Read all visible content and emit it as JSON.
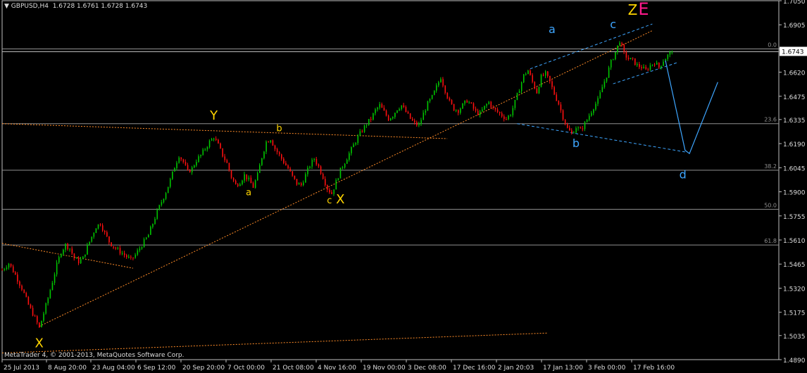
{
  "header": {
    "menu_glyph": "▼",
    "symbol": "GBPUSD,H4",
    "ohlc": "1.6728 1.6761 1.6728 1.6743"
  },
  "copyright": "MetaTrader 4, © 2001-2013, MetaQuotes Software Corp.",
  "colors": {
    "background": "#000000",
    "frame": "#c0c0c0",
    "grid": "#ffffff",
    "bull": "#00c800",
    "bear": "#ff1010",
    "trend": "#ff8c28",
    "wave_blue": "#3ea6ff",
    "wave_yellow": "#ffd400",
    "wave_magenta": "#ff1a8c",
    "fib": "#909090",
    "price_label_bg": "#ffffff"
  },
  "chart_data": {
    "type": "candlestick",
    "symbol": "GBPUSD",
    "timeframe": "H4",
    "ylim": [
      1.489,
      1.705
    ],
    "y_ticks": [
      "1.7050",
      "1.6905",
      "1.6760",
      "1.6620",
      "1.6475",
      "1.6335",
      "1.6190",
      "1.6045",
      "1.5900",
      "1.5755",
      "1.5610",
      "1.5465",
      "1.5320",
      "1.5175",
      "1.5035",
      "1.4890"
    ],
    "x_ticks": [
      "25 Jul 2013",
      "8 Aug 20:00",
      "23 Aug 04:00",
      "6 Sep 12:00",
      "20 Sep 20:00",
      "7 Oct 00:00",
      "21 Oct 08:00",
      "4 Nov 16:00",
      "19 Nov 00:00",
      "3 Dec 08:00",
      "17 Dec 16:00",
      "2 Jan 20:03",
      "17 Jan 13:00",
      "3 Feb 00:00",
      "17 Feb 16:00"
    ],
    "current_price": "1.6743",
    "fib_levels": [
      {
        "label": "0.0",
        "price": 1.676
      },
      {
        "label": "23.6",
        "price": 1.631
      },
      {
        "label": "38.2",
        "price": 1.603
      },
      {
        "label": "50.0",
        "price": 1.5795
      },
      {
        "label": "61.8",
        "price": 1.558
      }
    ],
    "path_points": [
      [
        0,
        1.543
      ],
      [
        3,
        1.547
      ],
      [
        6,
        1.54
      ],
      [
        9,
        1.532
      ],
      [
        12,
        1.522
      ],
      [
        15,
        1.514
      ],
      [
        17,
        1.508
      ],
      [
        19,
        1.517
      ],
      [
        21,
        1.526
      ],
      [
        23,
        1.536
      ],
      [
        25,
        1.546
      ],
      [
        27,
        1.554
      ],
      [
        29,
        1.558
      ],
      [
        31,
        1.556
      ],
      [
        33,
        1.55
      ],
      [
        35,
        1.548
      ],
      [
        37,
        1.55
      ],
      [
        39,
        1.557
      ],
      [
        41,
        1.563
      ],
      [
        43,
        1.569
      ],
      [
        45,
        1.571
      ],
      [
        47,
        1.565
      ],
      [
        49,
        1.56
      ],
      [
        51,
        1.557
      ],
      [
        53,
        1.555
      ],
      [
        55,
        1.553
      ],
      [
        57,
        1.551
      ],
      [
        59,
        1.549
      ],
      [
        61,
        1.552
      ],
      [
        63,
        1.556
      ],
      [
        65,
        1.56
      ],
      [
        67,
        1.564
      ],
      [
        69,
        1.571
      ],
      [
        71,
        1.578
      ],
      [
        73,
        1.584
      ],
      [
        75,
        1.59
      ],
      [
        77,
        1.597
      ],
      [
        79,
        1.605
      ],
      [
        81,
        1.612
      ],
      [
        83,
        1.608
      ],
      [
        85,
        1.602
      ],
      [
        87,
        1.604
      ],
      [
        89,
        1.609
      ],
      [
        91,
        1.612
      ],
      [
        93,
        1.616
      ],
      [
        95,
        1.62
      ],
      [
        97,
        1.623
      ],
      [
        99,
        1.618
      ],
      [
        101,
        1.612
      ],
      [
        103,
        1.607
      ],
      [
        105,
        1.599
      ],
      [
        107,
        1.594
      ],
      [
        109,
        1.596
      ],
      [
        111,
        1.6
      ],
      [
        113,
        1.597
      ],
      [
        115,
        1.593
      ],
      [
        117,
        1.6
      ],
      [
        119,
        1.611
      ],
      [
        121,
        1.62
      ],
      [
        123,
        1.622
      ],
      [
        125,
        1.616
      ],
      [
        127,
        1.612
      ],
      [
        129,
        1.608
      ],
      [
        131,
        1.604
      ],
      [
        133,
        1.599
      ],
      [
        135,
        1.595
      ],
      [
        137,
        1.594
      ],
      [
        139,
        1.6
      ],
      [
        141,
        1.606
      ],
      [
        143,
        1.61
      ],
      [
        145,
        1.605
      ],
      [
        147,
        1.599
      ],
      [
        149,
        1.592
      ],
      [
        151,
        1.589
      ],
      [
        153,
        1.596
      ],
      [
        155,
        1.603
      ],
      [
        157,
        1.608
      ],
      [
        159,
        1.613
      ],
      [
        161,
        1.618
      ],
      [
        163,
        1.623
      ],
      [
        165,
        1.627
      ],
      [
        167,
        1.631
      ],
      [
        169,
        1.634
      ],
      [
        171,
        1.639
      ],
      [
        173,
        1.642
      ],
      [
        175,
        1.638
      ],
      [
        177,
        1.634
      ],
      [
        179,
        1.636
      ],
      [
        181,
        1.64
      ],
      [
        183,
        1.642
      ],
      [
        185,
        1.638
      ],
      [
        187,
        1.634
      ],
      [
        189,
        1.631
      ],
      [
        191,
        1.63
      ],
      [
        193,
        1.637
      ],
      [
        195,
        1.643
      ],
      [
        197,
        1.647
      ],
      [
        199,
        1.653
      ],
      [
        201,
        1.659
      ],
      [
        203,
        1.651
      ],
      [
        205,
        1.644
      ],
      [
        207,
        1.64
      ],
      [
        209,
        1.639
      ],
      [
        211,
        1.642
      ],
      [
        213,
        1.645
      ],
      [
        215,
        1.642
      ],
      [
        217,
        1.638
      ],
      [
        219,
        1.637
      ],
      [
        221,
        1.641
      ],
      [
        223,
        1.644
      ],
      [
        225,
        1.64
      ],
      [
        227,
        1.638
      ],
      [
        229,
        1.636
      ],
      [
        231,
        1.634
      ],
      [
        233,
        1.637
      ],
      [
        235,
        1.644
      ],
      [
        237,
        1.652
      ],
      [
        239,
        1.66
      ],
      [
        241,
        1.663
      ],
      [
        243,
        1.656
      ],
      [
        245,
        1.65
      ],
      [
        247,
        1.659
      ],
      [
        249,
        1.661
      ],
      [
        251,
        1.656
      ],
      [
        253,
        1.649
      ],
      [
        255,
        1.643
      ],
      [
        257,
        1.635
      ],
      [
        259,
        1.628
      ],
      [
        261,
        1.625
      ],
      [
        263,
        1.629
      ],
      [
        265,
        1.627
      ],
      [
        267,
        1.631
      ],
      [
        269,
        1.636
      ],
      [
        271,
        1.641
      ],
      [
        273,
        1.645
      ],
      [
        275,
        1.653
      ],
      [
        277,
        1.66
      ],
      [
        279,
        1.668
      ],
      [
        281,
        1.674
      ],
      [
        283,
        1.681
      ],
      [
        285,
        1.673
      ],
      [
        287,
        1.67
      ],
      [
        289,
        1.669
      ],
      [
        291,
        1.666
      ],
      [
        293,
        1.665
      ],
      [
        295,
        1.663
      ],
      [
        297,
        1.666
      ],
      [
        299,
        1.668
      ],
      [
        301,
        1.665
      ],
      [
        303,
        1.669
      ],
      [
        305,
        1.672
      ],
      [
        307,
        1.6743
      ]
    ],
    "wave_labels": [
      {
        "text": "X",
        "index": 17,
        "price": 1.4965,
        "series": "yellow",
        "size": 18
      },
      {
        "text": "Y",
        "index": 97,
        "price": 1.6335,
        "series": "yellow",
        "size": 18
      },
      {
        "text": "a",
        "index": 113,
        "price": 1.588,
        "series": "yellow",
        "size": 13
      },
      {
        "text": "b",
        "index": 127,
        "price": 1.6265,
        "series": "yellow",
        "size": 13
      },
      {
        "text": "c",
        "index": 150,
        "price": 1.583,
        "series": "yellow",
        "size": 13
      },
      {
        "text": "X",
        "index": 155,
        "price": 1.583,
        "series": "yellow",
        "size": 18
      },
      {
        "text": "a",
        "index": 252,
        "price": 1.6855,
        "series": "blue",
        "size": 16
      },
      {
        "text": "b",
        "index": 263,
        "price": 1.617,
        "series": "blue",
        "size": 16
      },
      {
        "text": "c",
        "index": 280,
        "price": 1.6885,
        "series": "blue",
        "size": 16
      },
      {
        "text": "d",
        "index": 312,
        "price": 1.598,
        "series": "blue",
        "size": 16
      },
      {
        "text": "Z",
        "index": 289,
        "price": 1.6965,
        "series": "yellow",
        "size": 20
      },
      {
        "text": "E",
        "index": 294,
        "price": 1.6965,
        "series": "magenta",
        "size": 24
      }
    ],
    "trend_lines": [
      {
        "name": "main-uptrend",
        "from": [
          17,
          1.509
        ],
        "to": [
          298,
          1.687
        ]
      },
      {
        "name": "upper-left-arm",
        "from": [
          0,
          1.559
        ],
        "to": [
          60,
          1.544
        ]
      },
      {
        "name": "long-horizontal",
        "from": [
          0,
          1.631
        ],
        "to": [
          204,
          1.622
        ]
      },
      {
        "name": "lower-long",
        "from": [
          0,
          1.493
        ],
        "to": [
          250,
          1.505
        ]
      }
    ],
    "channel_lines": [
      {
        "name": "upper-channel",
        "from": [
          242,
          1.664
        ],
        "to": [
          298,
          1.691
        ]
      },
      {
        "name": "mid-channel",
        "from": [
          280,
          1.655
        ],
        "to": [
          310,
          1.668
        ]
      },
      {
        "name": "lower-channel",
        "from": [
          236,
          1.631
        ],
        "to": [
          313,
          1.614
        ]
      }
    ],
    "forecast": [
      [
        304,
        1.669
      ],
      [
        313,
        1.615
      ],
      [
        315,
        1.613
      ],
      [
        328,
        1.656
      ]
    ],
    "visible_bars": 356
  }
}
